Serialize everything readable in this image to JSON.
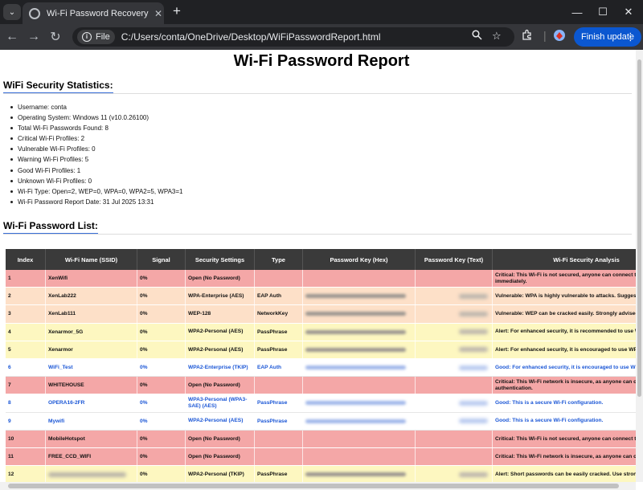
{
  "browser": {
    "tab_title": "Wi-Fi Password Recovery Report",
    "url_chip": "File",
    "url": "C:/Users/conta/OneDrive/Desktop/WiFiPasswordReport.html",
    "update_button": "Finish update",
    "new_tab_symbol": "+",
    "tab_close_symbol": "✕",
    "minimize_symbol": "—",
    "maximize_symbol": "☐",
    "close_symbol": "✕"
  },
  "page": {
    "title": "Wi-Fi Password Report",
    "stats_heading": "WiFi Security Statistics:",
    "list_heading": "Wi-Fi Password List:"
  },
  "stats": [
    "Username: conta",
    "Operating System: Windows 11 (v10.0.26100)",
    "Total Wi-Fi Passwords Found: 8",
    "Critical Wi-Fi Profiles: 2",
    "Vulnerable Wi-Fi Profiles: 0",
    "Warning Wi-Fi Profiles: 5",
    "Good Wi-Fi Profiles: 1",
    "Unknown Wi-Fi Profiles: 0",
    "Wi-Fi Type: Open=2, WEP=0, WPA=0, WPA2=5, WPA3=1",
    "Wi-Fi Password Report Date: 31 Jul 2025 13:31"
  ],
  "table": {
    "headers": [
      "Index",
      "Wi-Fi Name (SSID)",
      "Signal",
      "Security Settings",
      "Type",
      "Password Key (Hex)",
      "Password Key (Text)",
      "Wi-Fi Security Analysis"
    ],
    "rows": [
      {
        "index": "1",
        "ssid": "XenWifi",
        "signal": "0%",
        "security": "Open (No Password)",
        "type": "",
        "analysis": "Critical: This Wi-Fi is not secured, anyone can connect to it. Fix immediately.",
        "level": "critical",
        "hex": false,
        "text": false
      },
      {
        "index": "2",
        "ssid": "XenLab222",
        "signal": "0%",
        "security": "WPA-Enterprise (AES)",
        "type": "EAP Auth",
        "analysis": "Vulnerable: WPA is highly vulnerable to attacks. Suggested",
        "level": "vulnerable",
        "hex": true,
        "text": true
      },
      {
        "index": "3",
        "ssid": "XenLab111",
        "signal": "0%",
        "security": "WEP-128",
        "type": "NetworkKey",
        "analysis": "Vulnerable: WEP can be cracked easily. Strongly advised to",
        "level": "vulnerable",
        "hex": true,
        "text": true
      },
      {
        "index": "4",
        "ssid": "Xenarmor_5G",
        "signal": "0%",
        "security": "WPA2-Personal (AES)",
        "type": "PassPhrase",
        "analysis": "Alert: For enhanced security, it is recommended to use W",
        "level": "alert",
        "hex": true,
        "text": true
      },
      {
        "index": "5",
        "ssid": "Xenarmor",
        "signal": "0%",
        "security": "WPA2-Personal (AES)",
        "type": "PassPhrase",
        "analysis": "Alert: For enhanced security, it is encouraged to use WPA",
        "level": "alert",
        "hex": true,
        "text": true
      },
      {
        "index": "6",
        "ssid": "WiFi_Test",
        "signal": "0%",
        "security": "WPA2-Enterprise (TKIP)",
        "type": "EAP Auth",
        "analysis": "Good: For enhanced security, it is encouraged to use WPA",
        "level": "good",
        "hex": true,
        "text": true
      },
      {
        "index": "7",
        "ssid": "WHITEHOUSE",
        "signal": "0%",
        "security": "Open (No Password)",
        "type": "",
        "analysis": "Critical: This Wi-Fi network is insecure, as anyone can conn authentication.",
        "level": "critical",
        "hex": false,
        "text": false
      },
      {
        "index": "8",
        "ssid": "OPERA16-2FR",
        "signal": "0%",
        "security": "WPA3-Personal (WPA3-SAE) (AES)",
        "type": "PassPhrase",
        "analysis": "Good: This is a secure Wi-Fi configuration.",
        "level": "good",
        "hex": true,
        "text": true
      },
      {
        "index": "9",
        "ssid": "Mywifi",
        "signal": "0%",
        "security": "WPA2-Personal (AES)",
        "type": "PassPhrase",
        "analysis": "Good: This is a secure Wi-Fi configuration.",
        "level": "good",
        "hex": true,
        "text": true
      },
      {
        "index": "10",
        "ssid": "MobileHotspot",
        "signal": "0%",
        "security": "Open (No Password)",
        "type": "",
        "analysis": "Critical: This Wi-Fi is not secured, anyone can connect to it immediately.",
        "level": "critical",
        "hex": false,
        "text": false
      },
      {
        "index": "11",
        "ssid": "FREE_CCD_WIFI",
        "signal": "0%",
        "security": "Open (No Password)",
        "type": "",
        "analysis": "Critical: This Wi-Fi network is insecure, as anyone can conn hentication.",
        "level": "critical",
        "hex": false,
        "text": false
      },
      {
        "index": "12",
        "ssid": "",
        "signal": "0%",
        "security": "WPA2-Personal (TKIP)",
        "type": "PassPhrase",
        "analysis": "Alert: Short passwords can be easily cracked. Use strong racters.",
        "level": "alert",
        "hex": true,
        "text": true,
        "ssid_redacted": true
      }
    ]
  },
  "colors": {
    "critical": "#f4a7a7",
    "vulnerable": "#fde0c8",
    "alert": "#fdf7c0",
    "good": "#ffffff",
    "good_text": "#1a56d6",
    "default_text": "#111111",
    "header_bg": "#3a3a3a"
  }
}
